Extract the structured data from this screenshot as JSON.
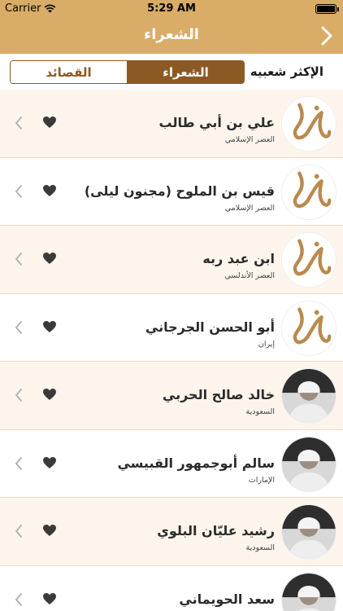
{
  "status": {
    "carrier": "Carrier",
    "time": "5:29 AM"
  },
  "nav": {
    "title": "الشعراء"
  },
  "segments": {
    "poems": "القصائد",
    "poets": "الشعراء",
    "popular": "الإكثر شعبيه"
  },
  "colors": {
    "header": "#d9ac67",
    "accent": "#8b5a24",
    "row_shade": "#fdf5ec"
  },
  "poets": [
    {
      "name": "علي بن أبي طالب",
      "subtitle": "العصر الإسلامي",
      "avatar": "logo-icon"
    },
    {
      "name": "قيس بن الملوح (مجنون ليلى)",
      "subtitle": "العصر الإسلامي",
      "avatar": "logo-icon"
    },
    {
      "name": "ابن عبد ربه",
      "subtitle": "العصر الأندلسي",
      "avatar": "logo-icon"
    },
    {
      "name": "أبو الحسن الجرجاني",
      "subtitle": "إيران",
      "avatar": "logo-icon"
    },
    {
      "name": "خالد صالح الحربي",
      "subtitle": "السعودية",
      "avatar": "photo"
    },
    {
      "name": "سالم أبوجمهور القبيسي",
      "subtitle": "الإمارات",
      "avatar": "photo"
    },
    {
      "name": "رشيد عليّان البلوي",
      "subtitle": "السعودية",
      "avatar": "photo"
    },
    {
      "name": "سعد الحويماني",
      "subtitle": "",
      "avatar": "photo"
    }
  ]
}
